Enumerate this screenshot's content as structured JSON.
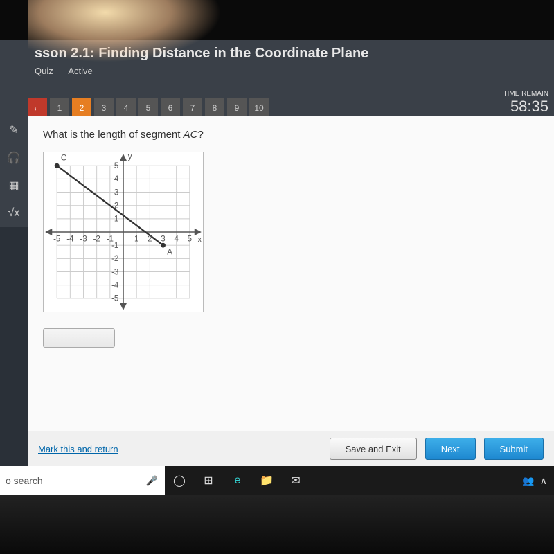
{
  "header": {
    "lesson_title": "sson 2.1: Finding Distance in the Coordinate Plane",
    "quiz_label": "Quiz",
    "active_label": "Active",
    "timer_label": "TIME REMAIN",
    "timer_value": "58:35"
  },
  "nav": {
    "back_arrow": "←",
    "questions": [
      "1",
      "2",
      "3",
      "4",
      "5",
      "6",
      "7",
      "8",
      "9",
      "10"
    ],
    "current_index": 1
  },
  "tools": {
    "pencil": "✎",
    "headphones": "🎧",
    "calculator": "▦",
    "sqrt": "√x"
  },
  "question": {
    "prompt_prefix": "What is the length of segment ",
    "segment_name": "AC",
    "prompt_suffix": "?",
    "answer_value": ""
  },
  "chart_data": {
    "type": "scatter",
    "title": "",
    "xlabel": "x",
    "ylabel": "y",
    "xlim": [
      -5,
      5
    ],
    "ylim": [
      -5,
      5
    ],
    "grid": true,
    "series": [
      {
        "name": "C",
        "values": [
          [
            -5,
            5
          ]
        ]
      },
      {
        "name": "A",
        "values": [
          [
            3,
            -1
          ]
        ]
      }
    ],
    "segment": {
      "from": "C",
      "to": "A"
    }
  },
  "footer": {
    "mark_link": "Mark this and return",
    "save_exit": "Save and Exit",
    "next": "Next",
    "submit": "Submit"
  },
  "taskbar": {
    "search_placeholder": "o search",
    "icons": {
      "cortana": "◯",
      "taskview": "⊞",
      "edge": "e",
      "explorer": "📁",
      "mail": "✉"
    },
    "right": {
      "people": "👥",
      "chevron": "∧"
    }
  }
}
